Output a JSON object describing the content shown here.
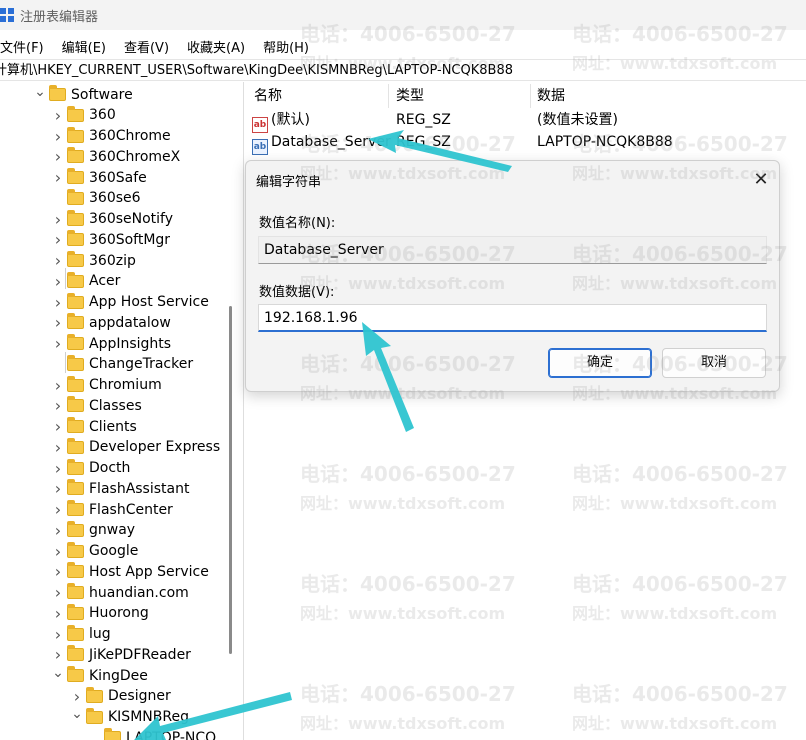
{
  "window": {
    "title": "注册表编辑器"
  },
  "menu": [
    "文件(F)",
    "编辑(E)",
    "查看(V)",
    "收藏夹(A)",
    "帮助(H)"
  ],
  "address": "计算机\\HKEY_CURRENT_USER\\Software\\KingDee\\KISMNBReg\\LAPTOP-NCQK8B88",
  "tree": {
    "items": [
      {
        "label": "Software",
        "state": "expanded"
      },
      {
        "label": "360",
        "state": "collapsed"
      },
      {
        "label": "360Chrome",
        "state": "collapsed"
      },
      {
        "label": "360ChromeX",
        "state": "collapsed"
      },
      {
        "label": "360Safe",
        "state": "collapsed"
      },
      {
        "label": "360se6",
        "state": "leaf"
      },
      {
        "label": "360seNotify",
        "state": "collapsed"
      },
      {
        "label": "360SoftMgr",
        "state": "collapsed"
      },
      {
        "label": "360zip",
        "state": "collapsed"
      },
      {
        "label": "Acer",
        "state": "collapsed"
      },
      {
        "label": "App Host Service",
        "state": "collapsed"
      },
      {
        "label": "appdatalow",
        "state": "collapsed"
      },
      {
        "label": "AppInsights",
        "state": "collapsed"
      },
      {
        "label": "ChangeTracker",
        "state": "leaf"
      },
      {
        "label": "Chromium",
        "state": "collapsed"
      },
      {
        "label": "Classes",
        "state": "collapsed"
      },
      {
        "label": "Clients",
        "state": "collapsed"
      },
      {
        "label": "Developer Express",
        "state": "collapsed"
      },
      {
        "label": "Docth",
        "state": "collapsed"
      },
      {
        "label": "FlashAssistant",
        "state": "collapsed"
      },
      {
        "label": "FlashCenter",
        "state": "collapsed"
      },
      {
        "label": "gnway",
        "state": "collapsed"
      },
      {
        "label": "Google",
        "state": "collapsed"
      },
      {
        "label": "Host App Service",
        "state": "collapsed"
      },
      {
        "label": "huandian.com",
        "state": "collapsed"
      },
      {
        "label": "Huorong",
        "state": "collapsed"
      },
      {
        "label": "lug",
        "state": "collapsed"
      },
      {
        "label": "JiKePDFReader",
        "state": "collapsed"
      },
      {
        "label": "KingDee",
        "state": "expanded"
      },
      {
        "label": "Designer",
        "state": "collapsed"
      },
      {
        "label": "KISMNBReg",
        "state": "expanded"
      },
      {
        "label": "LAPTOP-NCQ",
        "state": "leaf"
      }
    ]
  },
  "columns": {
    "name": "名称",
    "type": "类型",
    "data": "数据"
  },
  "values": [
    {
      "icon": "ab",
      "name": "(默认)",
      "type": "REG_SZ",
      "data": "(数值未设置)"
    },
    {
      "icon": "ab",
      "name": "Database_Server",
      "type": "REG_SZ",
      "data": "LAPTOP-NCQK8B88"
    }
  ],
  "dialog": {
    "title": "编辑字符串",
    "name_label": "数值名称(N):",
    "name_value": "Database_Server",
    "data_label": "数值数据(V):",
    "data_value": "192.168.1.96",
    "ok_label": "确定",
    "cancel_label": "取消"
  },
  "watermark": {
    "phone": "电话：4006-6500-27",
    "site": "网址：www.tdxsoft.com"
  },
  "colors": {
    "accent": "#2c6fd1",
    "arrow": "#2ec4d0",
    "folder": "#f7c948"
  }
}
